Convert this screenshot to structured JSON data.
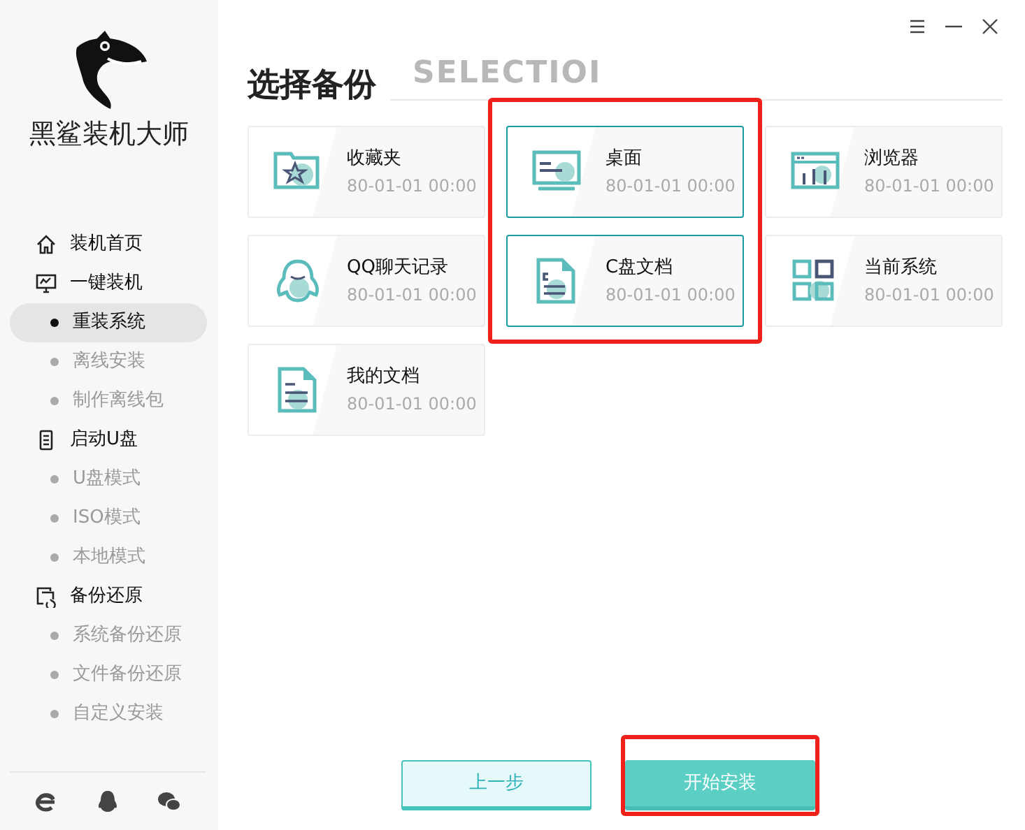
{
  "brand": {
    "name": "黑鲨装机大师"
  },
  "window_controls": [
    {
      "kind": "menu"
    },
    {
      "kind": "minimize"
    },
    {
      "kind": "close"
    }
  ],
  "sidebar": {
    "items": [
      {
        "label": "装机首页",
        "kind": "home"
      },
      {
        "label": "一键装机",
        "kind": "monitor",
        "children": [
          {
            "label": "重装系统",
            "selected": true
          },
          {
            "label": "离线安装",
            "selected": false
          },
          {
            "label": "制作离线包",
            "selected": false
          }
        ]
      },
      {
        "label": "启动U盘",
        "kind": "usb",
        "children": [
          {
            "label": "U盘模式",
            "selected": false
          },
          {
            "label": "ISO模式",
            "selected": false
          },
          {
            "label": "本地模式",
            "selected": false
          }
        ]
      },
      {
        "label": "备份还原",
        "kind": "restore",
        "children": [
          {
            "label": "系统备份还原",
            "selected": false
          },
          {
            "label": "文件备份还原",
            "selected": false
          },
          {
            "label": "自定义安装",
            "selected": false
          }
        ]
      }
    ],
    "footer_icons": [
      {
        "kind": "browser"
      },
      {
        "kind": "penguin"
      },
      {
        "kind": "chat"
      }
    ]
  },
  "page": {
    "title": "选择备份",
    "bg_title": "SELECTIOI"
  },
  "backups": [
    {
      "name": "收藏夹",
      "time": "80-01-01 00:00",
      "kind": "favorites",
      "selected": false
    },
    {
      "name": "桌面",
      "time": "80-01-01 00:00",
      "kind": "desktop",
      "selected": true,
      "framed": true
    },
    {
      "name": "浏览器",
      "time": "80-01-01 00:00",
      "kind": "browser",
      "selected": false
    },
    {
      "name": "QQ聊天记录",
      "time": "80-01-01 00:00",
      "kind": "qq",
      "selected": false
    },
    {
      "name": "C盘文档",
      "time": "80-01-01 00:00",
      "kind": "cdoc",
      "selected": true,
      "framed": true
    },
    {
      "name": "当前系统",
      "time": "80-01-01 00:00",
      "kind": "system",
      "selected": false
    },
    {
      "name": "我的文档",
      "time": "80-01-01 00:00",
      "kind": "document",
      "selected": false
    }
  ],
  "buttons": [
    {
      "label": "上一步",
      "kind": "back",
      "framed": false
    },
    {
      "label": "开始安装",
      "kind": "primary",
      "framed": true
    }
  ]
}
